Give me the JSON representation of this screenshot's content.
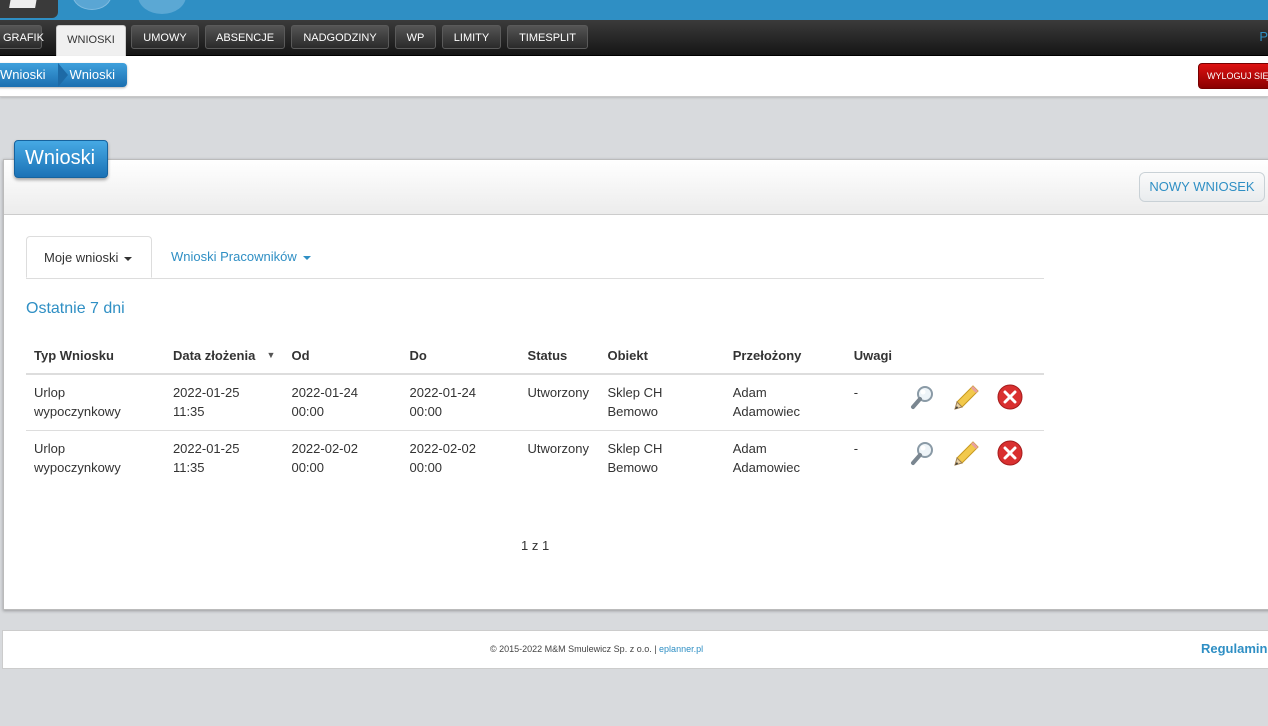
{
  "menu": {
    "items": [
      {
        "label": "GRAFIK"
      },
      {
        "label": "WNIOSKI",
        "active": true
      },
      {
        "label": "UMOWY"
      },
      {
        "label": "ABSENCJE"
      },
      {
        "label": "NADGODZINY"
      },
      {
        "label": "WP"
      },
      {
        "label": "LIMITY"
      },
      {
        "label": "TIMESPLIT"
      }
    ],
    "right_fragment": "P"
  },
  "breadcrumb": [
    "Wnioski",
    "Wnioski"
  ],
  "logout_label": "WYLOGUJ SIĘ",
  "panel": {
    "title": "Wnioski",
    "new_button": "NOWY WNIOSEK"
  },
  "tabs": [
    {
      "label": "Moje wnioski",
      "active": true
    },
    {
      "label": "Wnioski Pracowników"
    }
  ],
  "section_title": "Ostatnie 7 dni",
  "table": {
    "columns": [
      "Typ Wniosku",
      "Data złożenia",
      "Od",
      "Do",
      "Status",
      "Obiekt",
      "Przełożony",
      "Uwagi"
    ],
    "sort_indicator": "▼",
    "rows": [
      {
        "type": [
          "Urlop",
          "wypoczynkowy"
        ],
        "submitted": [
          "2022-01-25",
          "11:35"
        ],
        "from": [
          "2022-01-24",
          "00:00"
        ],
        "to": [
          "2022-01-24",
          "00:00"
        ],
        "status": "Utworzony",
        "object": [
          "Sklep CH",
          "Bemowo"
        ],
        "manager": [
          "Adam",
          "Adamowiec"
        ],
        "notes": "-"
      },
      {
        "type": [
          "Urlop",
          "wypoczynkowy"
        ],
        "submitted": [
          "2022-01-25",
          "11:35"
        ],
        "from": [
          "2022-02-02",
          "00:00"
        ],
        "to": [
          "2022-02-02",
          "00:00"
        ],
        "status": "Utworzony",
        "object": [
          "Sklep CH",
          "Bemowo"
        ],
        "manager": [
          "Adam",
          "Adamowiec"
        ],
        "notes": "-"
      }
    ]
  },
  "pager": "1 z 1",
  "footer": {
    "copyright": "© 2015-2022 M&M Smulewicz Sp. z o.o. | ",
    "link": "eplanner.pl",
    "regulamin": "Regulamin"
  },
  "colors": {
    "accent": "#2f8fc4",
    "logout": "#b30000",
    "menu_bg": "#222222"
  },
  "icons": [
    "view-magnifier-icon",
    "edit-pencil-icon",
    "delete-x-icon"
  ]
}
